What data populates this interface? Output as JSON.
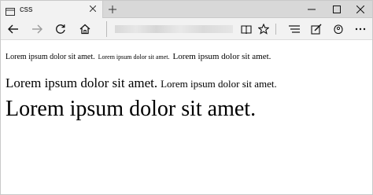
{
  "tab": {
    "title": "css",
    "icon": "page-icon"
  },
  "window_controls": {
    "minimize_icon": "minimize-icon",
    "maximize_icon": "maximize-icon",
    "close_icon": "close-icon"
  },
  "toolbar": {
    "back_icon": "back-arrow-icon",
    "forward_icon": "forward-arrow-icon",
    "refresh_icon": "refresh-icon",
    "home_icon": "home-icon",
    "reading_view_icon": "reading-view-icon",
    "favorites_icon": "star-icon",
    "hub_icon": "hub-icon",
    "notes_icon": "web-note-icon",
    "share_icon": "share-icon"
  },
  "content": {
    "line1": {
      "a": "Lorem ipsum dolor sit amet.",
      "b": "Lorem ipsum dolor sit amet.",
      "c": "Lorem ipsum dolor sit amet."
    },
    "line2": {
      "a": "Lorem ipsum dolor sit amet.",
      "b": "Lorem ipsum dolor sit amet."
    },
    "line3": {
      "a": "Lorem ipsum dolor sit amet."
    }
  }
}
